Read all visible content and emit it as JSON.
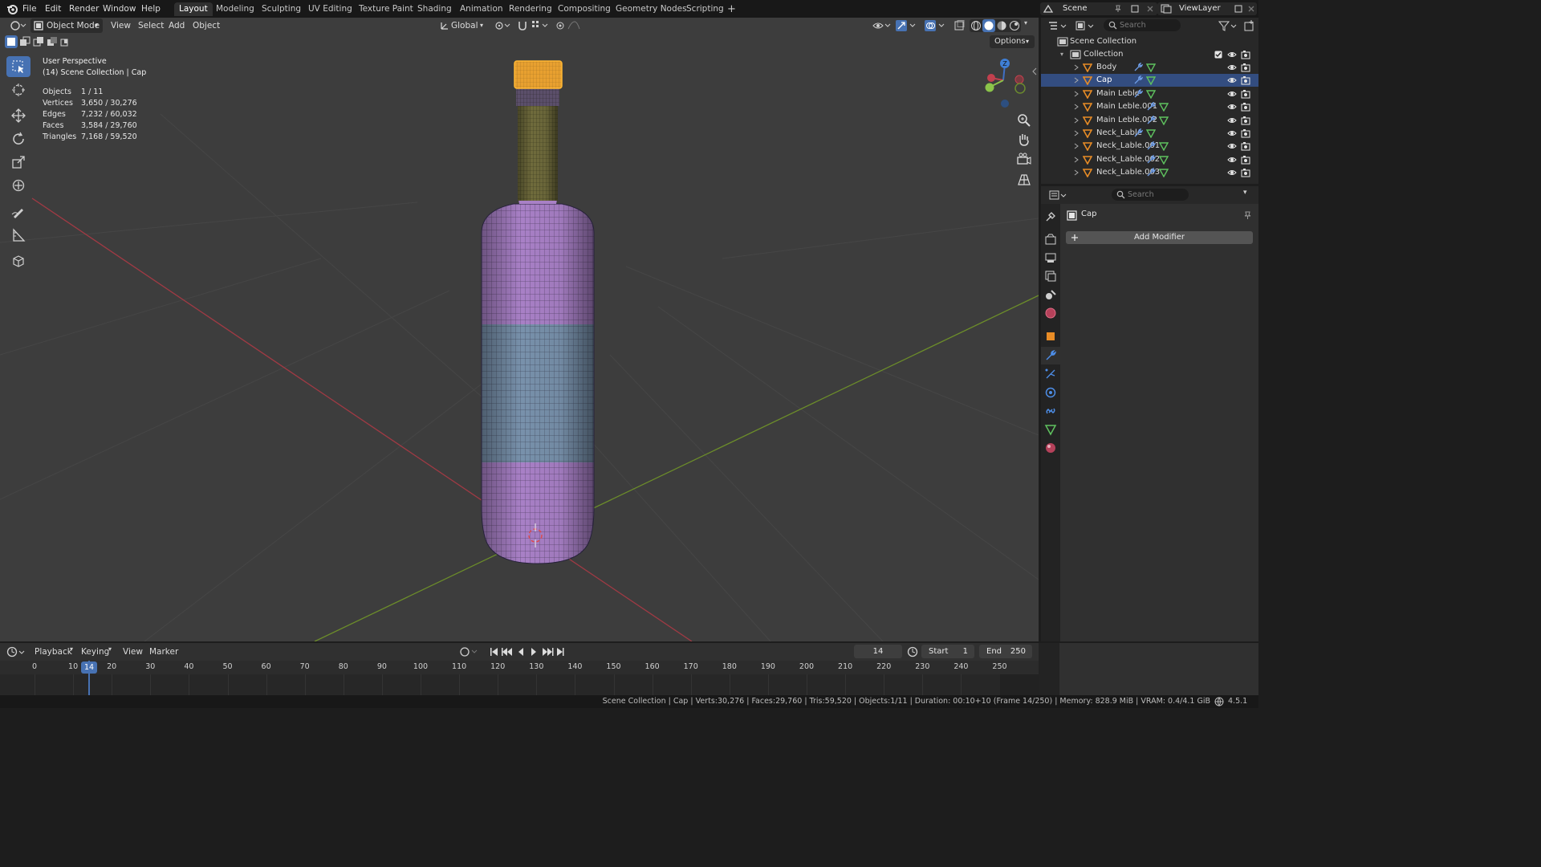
{
  "menu": [
    "File",
    "Edit",
    "Render",
    "Window",
    "Help"
  ],
  "workspaces": [
    "Layout",
    "Modeling",
    "Sculpting",
    "UV Editing",
    "Texture Paint",
    "Shading",
    "Animation",
    "Rendering",
    "Compositing",
    "Geometry Nodes",
    "Scripting"
  ],
  "add_workspace": "+",
  "scene_name": "Scene",
  "view_layer": "ViewLayer",
  "viewport": {
    "mode": "Object Mode",
    "menus": [
      "View",
      "Select",
      "Add",
      "Object"
    ],
    "transform_orientation": "Global",
    "options_label": "Options",
    "view_name": "User Perspective",
    "collection_info": "(14) Scene Collection | Cap",
    "stats": [
      {
        "label": "Objects",
        "value": "1 / 11"
      },
      {
        "label": "Vertices",
        "value": "3,650 / 30,276"
      },
      {
        "label": "Edges",
        "value": "7,232 / 60,032"
      },
      {
        "label": "Faces",
        "value": "3,584 / 29,760"
      },
      {
        "label": "Triangles",
        "value": "7,168 / 59,520"
      }
    ],
    "gizmo_z": "Z"
  },
  "outliner": {
    "search_placeholder": "Search",
    "root": "Scene Collection",
    "collection": "Collection",
    "items": [
      "Body",
      "Cap",
      "Main Leble",
      "Main Leble.001",
      "Main Leble.002",
      "Neck_Lable",
      "Neck_Lable.001",
      "Neck_Lable.002",
      "Neck_Lable.003"
    ],
    "selected": "Cap"
  },
  "properties": {
    "search_placeholder": "Search",
    "object_name": "Cap",
    "add_modifier": "Add Modifier"
  },
  "timeline": {
    "menus": [
      "Playback",
      "Keying",
      "View",
      "Marker"
    ],
    "current_frame": "14",
    "start_label": "Start",
    "start": "1",
    "end_label": "End",
    "end": "250",
    "ruler": [
      "0",
      "10",
      "20",
      "30",
      "40",
      "50",
      "60",
      "70",
      "80",
      "90",
      "100",
      "110",
      "120",
      "130",
      "140",
      "150",
      "160",
      "170",
      "180",
      "190",
      "200",
      "210",
      "220",
      "230",
      "240",
      "250"
    ]
  },
  "statusbar": {
    "text": "Scene Collection | Cap | Verts:30,276 | Faces:29,760 | Tris:59,520 | Objects:1/11 | Duration: 00:10+10 (Frame 14/250) | Memory: 828.9 MiB | VRAM: 0.4/4.1 GiB",
    "version": "4.5.1"
  },
  "colors": {
    "accent": "#4772b3",
    "bottle_purple": "#a880c6",
    "label_blue": "#7891ab",
    "cap_orange": "#e8a030",
    "neck_olive": "#6f6b3c",
    "axis_x": "#a03a44",
    "axis_y": "#6c8d2a"
  }
}
